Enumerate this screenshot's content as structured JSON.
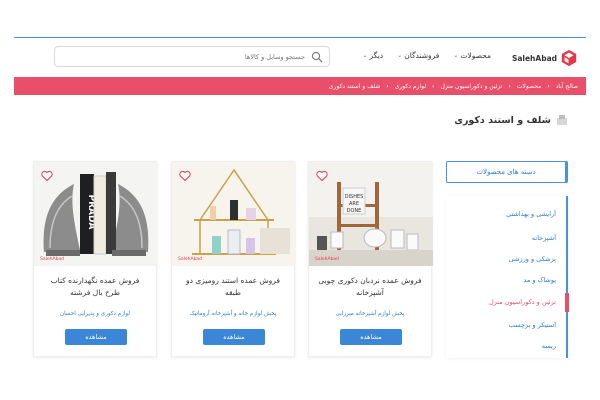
{
  "header": {
    "logo_text": "SalehAbad",
    "nav": [
      {
        "label": "محصولات"
      },
      {
        "label": "فروشندگان"
      },
      {
        "label": "دیگر"
      }
    ],
    "search_placeholder": "جستجو وسایل و کالاها"
  },
  "breadcrumb": [
    "صالح آباد",
    "محصولات",
    "تزئین و دکوراسیون منزل",
    "لوازم دکوری",
    "شلف و استند دکوری"
  ],
  "page_title": "شلف و استند دکوری",
  "sidebar": {
    "header": "دسته های محصولات",
    "items": [
      {
        "label": "آرایشی و بهداشتی"
      },
      {
        "label": "آشپزخانه"
      },
      {
        "label": "پزشکی و ورزشی"
      },
      {
        "label": "پوشاک و مد"
      },
      {
        "label": "تزئین و دکوراسیون منزل"
      },
      {
        "label": "استیکر و برچسب"
      },
      {
        "label": "ریسه"
      }
    ],
    "active_index": 4
  },
  "products": [
    {
      "title": "فروش عمده نردبان دکوری چوبی آشپزخانه",
      "seller": "پخش لوازم آشپزخانه میرزایی",
      "button": "مشاهده",
      "watermark": "SalehAbad"
    },
    {
      "title": "فروش عمده استند رومیزی دو طبقه",
      "seller": "پخش لوازم خانه و آشپزخانه آروماتیک",
      "button": "مشاهده",
      "watermark": "SalehAbad"
    },
    {
      "title": "فروش عمده نگهدارنده کتاب طرح بال فرشته",
      "seller": "لوازم دکوری و پذیرایی احسان",
      "button": "مشاهده",
      "watermark": "SalehAbad",
      "book_text": "PRADA"
    }
  ],
  "colors": {
    "accent": "#e94f6b",
    "primary": "#3b86d6",
    "link": "#2a7dd1"
  }
}
